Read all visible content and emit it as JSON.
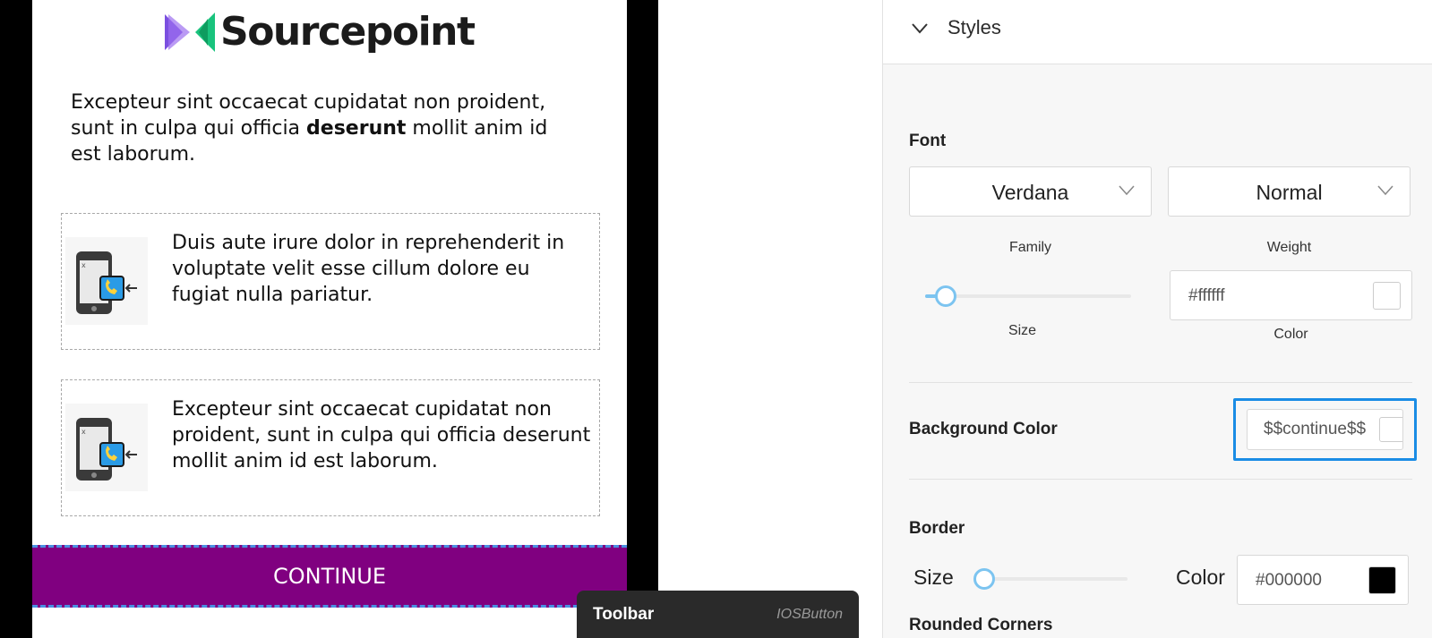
{
  "preview": {
    "logo_text": "Sourcepoint",
    "intro_before": "Excepteur sint occaecat cupidatat non proident, sunt in culpa qui officia ",
    "intro_bold": "deserunt",
    "intro_after": " mollit anim id est laborum.",
    "cards": [
      {
        "text": "Duis aute irure dolor in reprehenderit in voluptate velit esse cillum dolore eu fugiat nulla pariatur.",
        "icon": "phone-call-icon"
      },
      {
        "text": "Excepteur sint occaecat cupidatat non proident, sunt in culpa qui officia deserunt mollit anim id est laborum.",
        "icon": "phone-call-icon"
      }
    ],
    "continue_label": "CONTINUE",
    "continue_bg": "#800080"
  },
  "toolbar": {
    "title": "Toolbar",
    "component": "IOSButton"
  },
  "panel": {
    "section_title": "Styles",
    "font": {
      "label": "Font",
      "family_value": "Verdana",
      "family_label": "Family",
      "weight_value": "Normal",
      "weight_label": "Weight",
      "size_label": "Size",
      "size_fraction": 0.1,
      "color_value": "#ffffff",
      "color_label": "Color"
    },
    "background": {
      "label": "Background Color",
      "value": "$$continue$$"
    },
    "border": {
      "label": "Border",
      "size_label": "Size",
      "size_fraction": 0.0,
      "color_label": "Color",
      "color_value": "#000000"
    },
    "rounded_corners_label": "Rounded Corners"
  },
  "colors": {
    "accent": "#1a8ce5",
    "slider": "#7cc4f0",
    "button_purple": "#800080"
  }
}
